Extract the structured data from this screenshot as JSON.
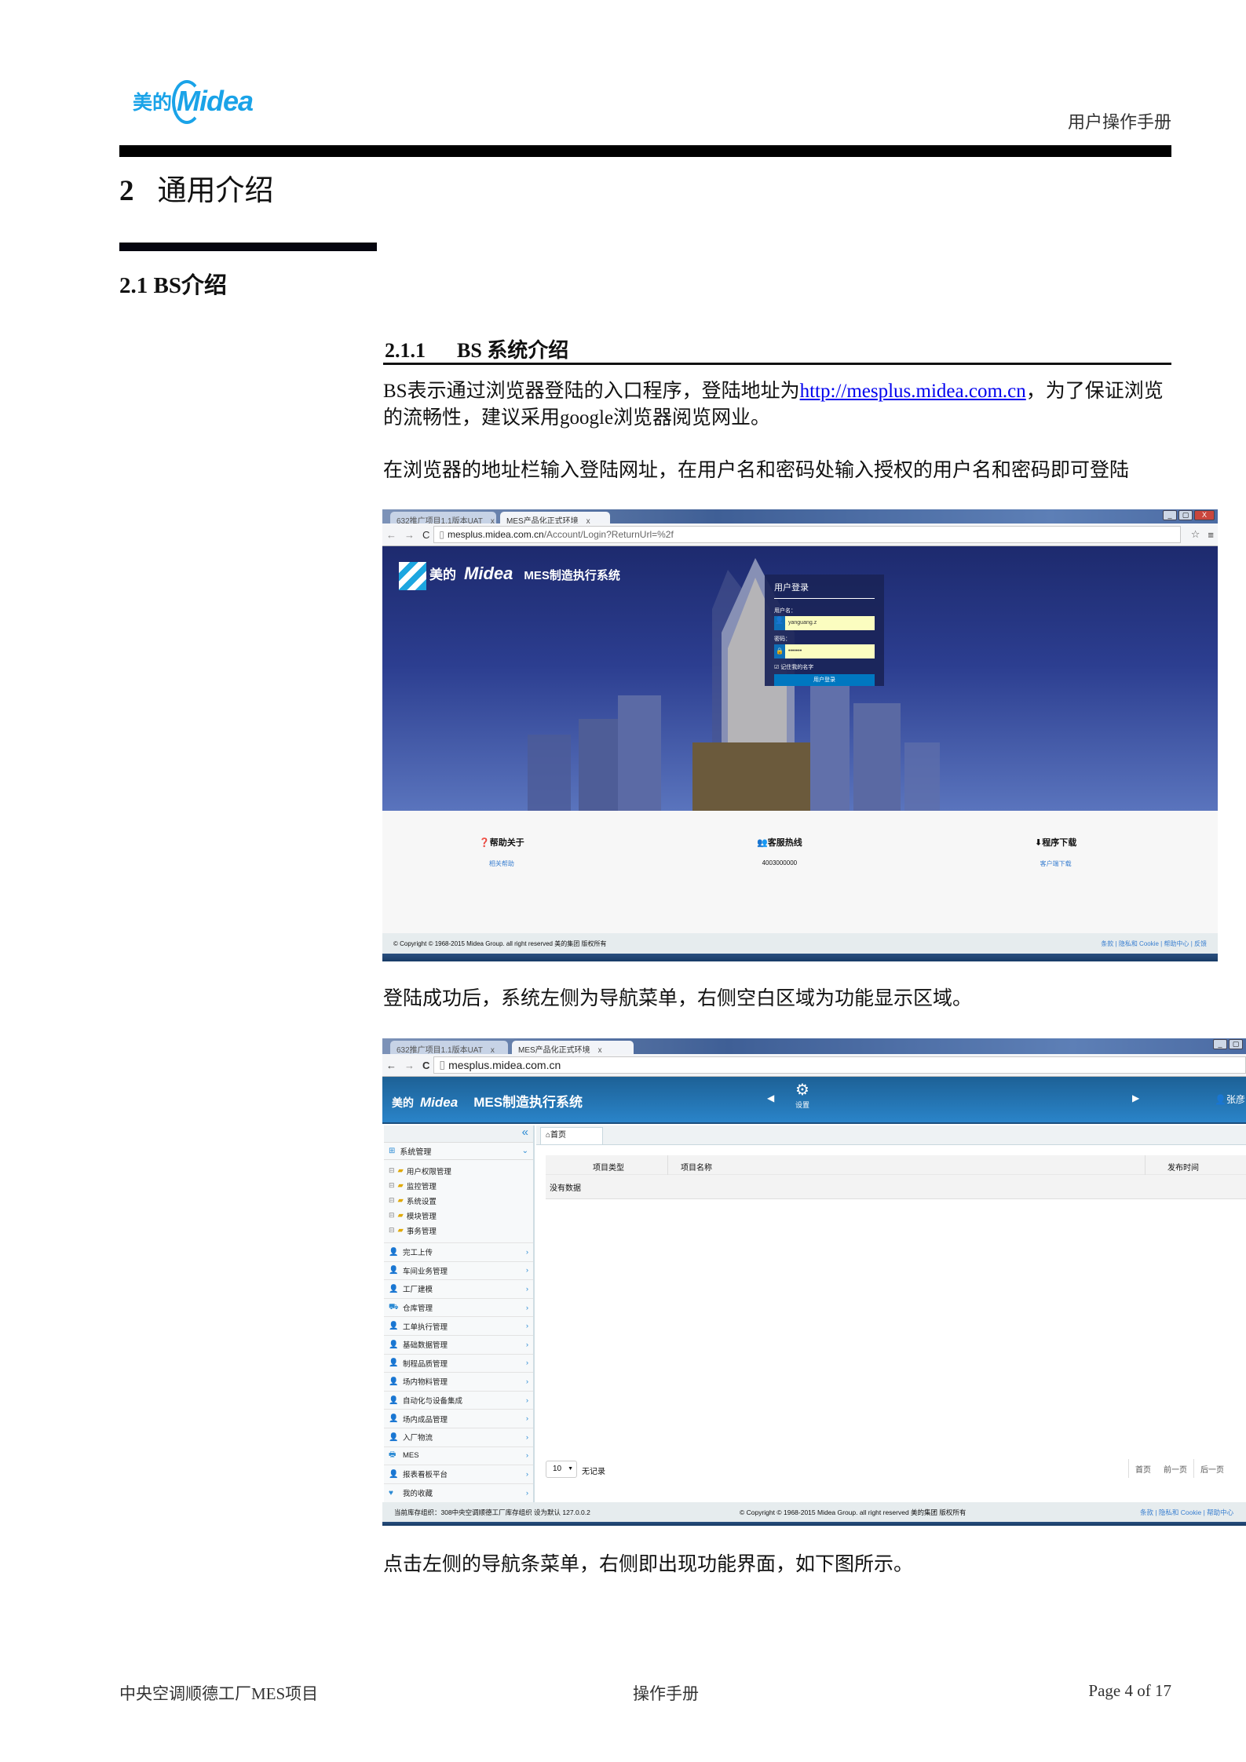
{
  "header": {
    "logo_cn": "美的",
    "logo_en": "Midea",
    "doc_type": "用户操作手册"
  },
  "section": {
    "num": "2",
    "title": "通用介绍"
  },
  "subsection": {
    "num": "2.1",
    "title": "BS介绍"
  },
  "subsubsection": {
    "num": "2.1.1",
    "title": "BS 系统介绍"
  },
  "paragraphs": {
    "p1_before": "BS表示通过浏览器登陆的入口程序，登陆地址为",
    "p1_link": "http://mesplus.midea.com.cn",
    "p1_after": "，为了保证浏览的流畅性，建议采用google浏览器阅览网业。",
    "p2": "在浏览器的地址栏输入登陆网址，在用户名和密码处输入授权的用户名和密码即可登陆",
    "p3": "登陆成功后，系统左侧为导航菜单，右侧空白区域为功能显示区域。",
    "p4": "点击左侧的导航条菜单，右侧即出现功能界面，如下图所示。"
  },
  "login_shot": {
    "tabs": [
      "632推广项目1.1版本UAT",
      "MES产品化正式环境"
    ],
    "url_host": "mesplus.midea.com.cn",
    "url_path": "/Account/Login?ReturnUrl=%2f",
    "brand_cn": "美的",
    "brand_en": "Midea",
    "system_name": "MES制造执行系统",
    "panel_title": "用户登录",
    "username_label": "用户名：",
    "username_value": "yanguang.z",
    "password_label": "密码：",
    "password_value": "•••••••",
    "remember_label": "记住我的名字",
    "remember_checked": true,
    "login_button": "用户登录",
    "help": {
      "title": "帮助关于",
      "link": "相关帮助"
    },
    "hotline": {
      "title": "客服热线",
      "number": "4003000000"
    },
    "download": {
      "title": "程序下载",
      "link": "客户端下载"
    },
    "copyright": "© Copyright © 1968-2015 Midea Group. all right reserved 美的集团 版权所有",
    "footer_links": "条款 | 隐私和 Cookie | 帮助中心 | 反馈",
    "colors": {
      "banner": "#2b3f8f",
      "panel": "#1f2d64",
      "button": "#0077c0",
      "input": "#fbfdc0",
      "link": "#3a7fd0"
    }
  },
  "main_shot": {
    "tabs": [
      "632推广项目1.1版本UAT",
      "MES产品化正式环境"
    ],
    "url_host": "mesplus.midea.com.cn",
    "brand_cn": "美的",
    "brand_en": "Midea",
    "system_name": "MES制造执行系统",
    "settings_label": "设置",
    "user": "张彦",
    "sidebar": {
      "group": "系统管理",
      "tree": [
        "用户权限管理",
        "监控管理",
        "系统设置",
        "模块管理",
        "事务管理"
      ],
      "menu": [
        {
          "label": "完工上传",
          "icon": "user"
        },
        {
          "label": "车间业务管理",
          "icon": "user"
        },
        {
          "label": "工厂建模",
          "icon": "user"
        },
        {
          "label": "仓库管理",
          "icon": "warehouse"
        },
        {
          "label": "工单执行管理",
          "icon": "user"
        },
        {
          "label": "基础数据管理",
          "icon": "user"
        },
        {
          "label": "制程品质管理",
          "icon": "user"
        },
        {
          "label": "场内物料管理",
          "icon": "user"
        },
        {
          "label": "自动化与设备集成",
          "icon": "user"
        },
        {
          "label": "场内成品管理",
          "icon": "user"
        },
        {
          "label": "入厂物流",
          "icon": "user"
        },
        {
          "label": "MES",
          "icon": "printer"
        },
        {
          "label": "报表看板平台",
          "icon": "user"
        },
        {
          "label": "我的收藏",
          "icon": "heart"
        }
      ]
    },
    "home_tab": "首页",
    "table": {
      "columns": [
        "项目类型",
        "项目名称",
        "发布时间"
      ],
      "empty": "没有数据"
    },
    "pager": {
      "page_size": "10",
      "records": "无记录",
      "first": "首页",
      "prev": "前一页",
      "next": "后一页"
    },
    "status_left": "当前库存组织：308中央空调顺德工厂库存组织 设为默认 127.0.0.2",
    "status_center": "© Copyright © 1968-2015 Midea Group. all right reserved 美的集团 版权所有",
    "status_right": "条款 | 隐私和 Cookie | 帮助中心",
    "colors": {
      "header": "#1f6aa8",
      "accent": "#2a8ad4",
      "sidebar_bg": "#f7f9fa"
    }
  },
  "footer": {
    "project": "中央空调顺德工厂MES项目",
    "center": "操作手册",
    "page": "Page 4 of 17"
  }
}
